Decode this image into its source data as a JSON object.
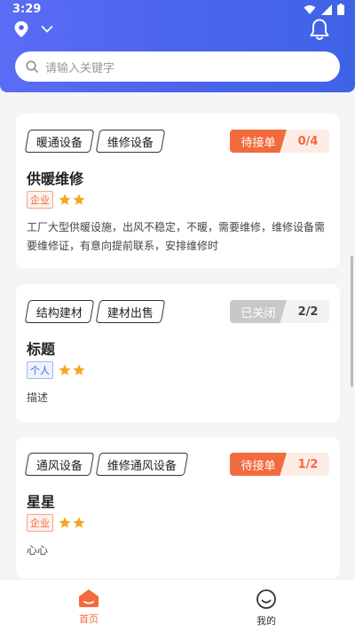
{
  "status_bar": {
    "time": "3:29"
  },
  "search": {
    "placeholder": "请输入关键字"
  },
  "orders": [
    {
      "tags": [
        "暖通设备",
        "维修设备"
      ],
      "status": "待接单",
      "count": "0/4",
      "title": "供暖维修",
      "type": "企业",
      "stars": 2,
      "description": "工厂大型供暖设施，出风不稳定，不暖，需要维修，维修设备需要维修证，有意向提前联系，安排维修时"
    },
    {
      "tags": [
        "结构建材",
        "建材出售"
      ],
      "status": "已关闭",
      "count": "2/2",
      "title": "标题",
      "type": "个人",
      "stars": 2,
      "description": "描述"
    },
    {
      "tags": [
        "通风设备",
        "维修通风设备"
      ],
      "status": "待接单",
      "count": "1/2",
      "title": "星星",
      "type": "企业",
      "stars": 2,
      "description": "心心"
    }
  ],
  "tabbar": {
    "home": "首页",
    "mine": "我的"
  },
  "colors": {
    "accent": "#f26b3d",
    "header": "#4d65ee",
    "star": "#f5a623"
  }
}
